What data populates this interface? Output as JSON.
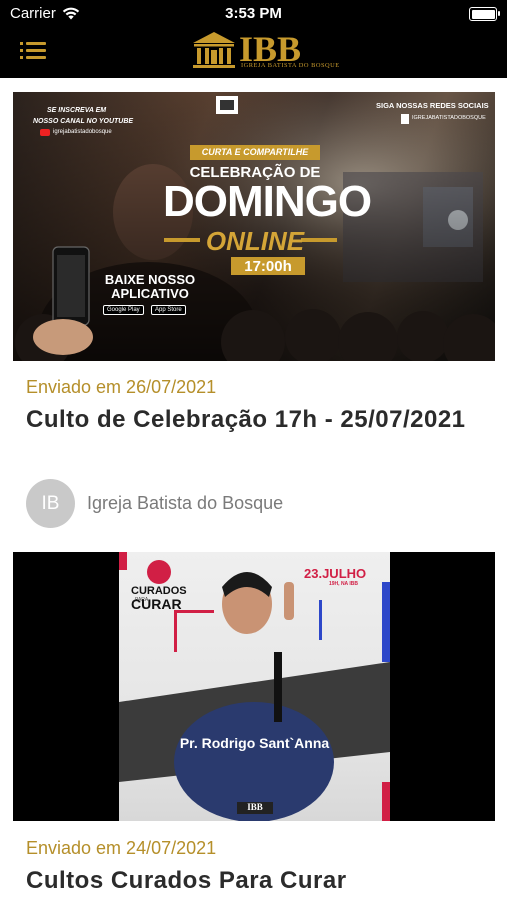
{
  "status": {
    "carrier": "Carrier",
    "time": "3:53 PM"
  },
  "header": {
    "logo_abbr": "IBB",
    "logo_full": "Igreja Batista do Bosque"
  },
  "posts": [
    {
      "date": "Enviado em 26/07/2021",
      "title": "Culto de Celebração 17h - 25/07/2021",
      "author_initials": "IB",
      "author": "Igreja Batista do Bosque",
      "banner": {
        "subscribe_1": "SE INSCREVA EM",
        "subscribe_2": "NOSSO CANAL NO YOUTUBE",
        "channel": "igrejabatistadobosque",
        "follow": "SIGA NOSSAS REDES SOCIAIS",
        "handle": "IGREJABATISTADOBOSQUE",
        "share": "CURTA E COMPARTILHE",
        "celebration": "CELEBRAÇÃO DE",
        "sunday": "DOMINGO",
        "online": "ONLINE",
        "time": "17:00h",
        "download_1": "BAIXE NOSSO",
        "download_2": "APLICATIVO",
        "store_1": "Google Play",
        "store_2": "App Store"
      }
    },
    {
      "date": "Enviado em 24/07/2021",
      "title": "Cultos Curados Para Curar",
      "banner": {
        "event_1": "CURADOS",
        "event_2": "CURAR",
        "event_small": "PARA",
        "date": "23.JULHO",
        "date_sub": "19H, NA IBB",
        "speaker": "Pr. Rodrigo Sant`Anna",
        "footer_logo": "IBB"
      }
    }
  ]
}
